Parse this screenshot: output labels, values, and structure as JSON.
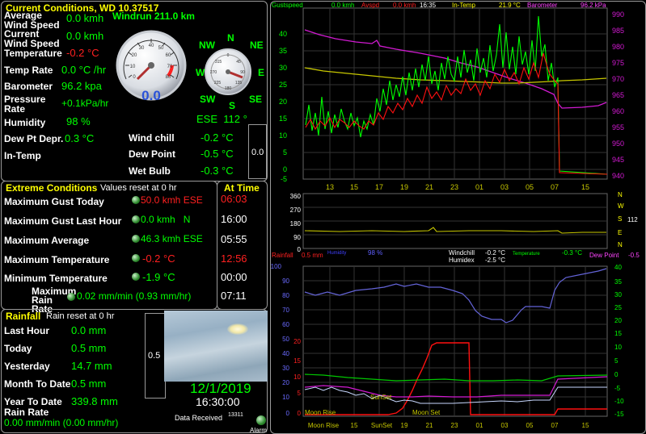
{
  "current": {
    "title": "Current Conditions, WD 10.37517",
    "windrun": "Windrun 211.0 km",
    "rows": [
      {
        "label": "Average Wind Speed",
        "value": "0.0 kmh"
      },
      {
        "label": "Current Wind Speed",
        "value": "0.0 kmh"
      },
      {
        "label": "Temperature",
        "value": "-0.2 °C"
      },
      {
        "label": "Temp Rate",
        "value": "0.0 °C /hr"
      },
      {
        "label": "Barometer",
        "value": "96.2 kpa"
      },
      {
        "label": "Pressure Rate",
        "value": "+0.1kPa/hr"
      },
      {
        "label": "Humidity",
        "value": "98 %"
      },
      {
        "label": "Dew Pt Depr.",
        "value": "0.3 °C"
      },
      {
        "label": "In-Temp",
        "value": ""
      }
    ],
    "feels": [
      {
        "label": "Wind chill",
        "value": "-0.2 °C"
      },
      {
        "label": "Dew Point",
        "value": "-0.5 °C"
      },
      {
        "label": "Wet Bulb",
        "value": "-0.3 °C"
      }
    ],
    "intemp_box": "0.0",
    "gauge_value": "0.0",
    "direction": "ESE  112 °",
    "compass": {
      "nw": "NW",
      "n": "N",
      "ne": "NE",
      "w": "W",
      "e": "E",
      "sw": "SW",
      "s": "S",
      "se": "SE"
    }
  },
  "extreme": {
    "title": "Extreme Conditions",
    "reset": "Values reset at 0 hr",
    "at_time": "At Time",
    "rows": [
      {
        "label": "Maximum Gust Today",
        "value": "50.0 kmh ESE",
        "time": "06:03"
      },
      {
        "label": "Maximum Gust Last Hour",
        "value": "0.0 kmh   N",
        "time": "16:00"
      },
      {
        "label": "Maximum Average",
        "value": "46.3 kmh ESE",
        "time": "05:55"
      },
      {
        "label": "Maximum Temperature",
        "value": "-0.2 °C",
        "time": "12:56"
      },
      {
        "label": "Minimum Temperature",
        "value": "-1.9 °C",
        "time": "00:00"
      },
      {
        "label": "Maximum Rain Rate",
        "value": "0.02 mm/min (0.93 mm/hr)",
        "time": "07:11"
      }
    ]
  },
  "rain": {
    "title": "Rainfall",
    "reset": "Rain reset at 0 hr",
    "rows": [
      {
        "label": "Last Hour",
        "value": "0.0 mm"
      },
      {
        "label": "Today",
        "value": "0.5 mm"
      },
      {
        "label": "Yesterday",
        "value": "14.7 mm"
      },
      {
        "label": "Month To Date",
        "value": "0.5 mm"
      },
      {
        "label": "Year To Date",
        "value": "339.8 mm"
      }
    ],
    "rate_label": "Rain Rate",
    "rate_value": "0.00 mm/min (0.00 mm/hr)",
    "gauge": "0.5",
    "date": "12/1/2019",
    "time": "16:30:00",
    "data_received_label": "Data Received",
    "data_received": "13311",
    "alarm": "Alarm"
  },
  "graph_top": {
    "legend": [
      {
        "text": "Gustspeed",
        "color": "#00ff00"
      },
      {
        "text": "0.0 kmh",
        "color": "#00ff00"
      },
      {
        "text": "Avspd",
        "color": "#ff2020"
      },
      {
        "text": "0.0 kmh",
        "color": "#ff2020"
      },
      {
        "text": "16:35",
        "color": "#ffffff"
      },
      {
        "text": "In-Temp",
        "color": "#ffff00"
      },
      {
        "text": "21.9 °C",
        "color": "#ffff00"
      },
      {
        "text": "Barometer",
        "color": "#ff44ff"
      },
      {
        "text": "96.2 kPa",
        "color": "#ff44ff"
      }
    ],
    "y_left": [
      "40",
      "35",
      "30",
      "25",
      "20",
      "15",
      "10",
      "5",
      "0",
      "-5"
    ],
    "y_right": [
      "990",
      "985",
      "980",
      "975",
      "970",
      "965",
      "960",
      "955",
      "950",
      "945",
      "940"
    ],
    "x": [
      "13",
      "15",
      "17",
      "19",
      "21",
      "23",
      "01",
      "03",
      "05",
      "07",
      "15"
    ]
  },
  "graph_mid": {
    "y": [
      "360",
      "270",
      "180",
      "90",
      "0"
    ],
    "dirs": [
      "N",
      "W",
      "S",
      "E",
      "N"
    ],
    "dir_value": "112",
    "footer": [
      {
        "text": "Rainfall",
        "color": "#ff2020"
      },
      {
        "text": "0.5 mm",
        "color": "#ff2020"
      },
      {
        "text": "Humidity",
        "color": "#4040ff"
      },
      {
        "text": "98 %",
        "color": "#6060ff"
      },
      {
        "text": "Windchill",
        "color": "#ffffff"
      },
      {
        "text": "-0.2 °C",
        "color": "#ffffff"
      },
      {
        "text": "Humidex",
        "color": "#ffffff"
      },
      {
        "text": "-2.5 °C",
        "color": "#ffffff"
      },
      {
        "text": "Temperature",
        "color": "#00ff00"
      },
      {
        "text": "-0.3 °C",
        "color": "#00ff00"
      },
      {
        "text": "Dew Point",
        "color": "#ff44ff"
      },
      {
        "text": "-0.5",
        "color": "#ff44ff"
      }
    ]
  },
  "graph_bot": {
    "y_left": [
      "100",
      "90",
      "80",
      "70",
      "60",
      "50",
      "40",
      "30",
      "20",
      "10",
      "0"
    ],
    "y_red": [
      "20",
      "15",
      "10",
      "5",
      "0"
    ],
    "y_right": [
      "40",
      "35",
      "30",
      "25",
      "20",
      "15",
      "10",
      "5",
      "0",
      "-5",
      "-10",
      "-15"
    ],
    "x": [
      "Moon Rise",
      "15",
      "SunSet",
      "19",
      "21",
      "23",
      "01",
      "03",
      "05",
      "07",
      "15"
    ],
    "labels": {
      "moonrise": "Moon Rise",
      "sunset": "SunSet",
      "moonset": "Moon Set"
    }
  }
}
